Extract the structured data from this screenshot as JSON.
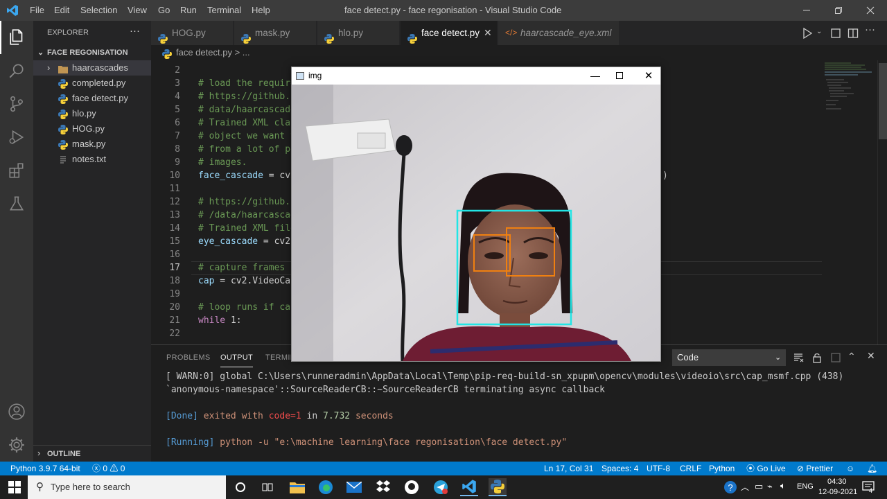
{
  "window": {
    "title": "face detect.py - face regonisation - Visual Studio Code",
    "menu": [
      "File",
      "Edit",
      "Selection",
      "View",
      "Go",
      "Run",
      "Terminal",
      "Help"
    ]
  },
  "sidebar": {
    "title": "EXPLORER",
    "more": "···",
    "folder": "FACE REGONISATION",
    "items": [
      {
        "label": "haarcascades",
        "type": "folder"
      },
      {
        "label": "completed.py",
        "type": "python"
      },
      {
        "label": "face detect.py",
        "type": "python"
      },
      {
        "label": "hlo.py",
        "type": "python"
      },
      {
        "label": "HOG.py",
        "type": "python"
      },
      {
        "label": "mask.py",
        "type": "python"
      },
      {
        "label": "notes.txt",
        "type": "text"
      }
    ],
    "outline": "OUTLINE"
  },
  "tabs": [
    {
      "label": "HOG.py",
      "active": false
    },
    {
      "label": "mask.py",
      "active": false
    },
    {
      "label": "hlo.py",
      "active": false
    },
    {
      "label": "face detect.py",
      "active": true
    },
    {
      "label": "haarcascade_eye.xml",
      "active": false
    }
  ],
  "breadcrumb": {
    "file": "face detect.py",
    "rest": "> ..."
  },
  "editor": {
    "lines": [
      {
        "n": "2",
        "parts": []
      },
      {
        "n": "3",
        "parts": [
          {
            "c": "cmt",
            "t": "# load the require"
          }
        ]
      },
      {
        "n": "4",
        "parts": [
          {
            "c": "cmt",
            "t": "# https://github.c"
          }
        ]
      },
      {
        "n": "5",
        "parts": [
          {
            "c": "cmt",
            "t": "# data/haarcascade"
          }
        ]
      },
      {
        "n": "6",
        "parts": [
          {
            "c": "cmt",
            "t": "# Trained XML clas"
          }
        ]
      },
      {
        "n": "7",
        "parts": [
          {
            "c": "cmt",
            "t": "# object we want t"
          }
        ]
      },
      {
        "n": "8",
        "parts": [
          {
            "c": "cmt",
            "t": "# from a lot of po"
          }
        ]
      },
      {
        "n": "9",
        "parts": [
          {
            "c": "cmt",
            "t": "# images."
          }
        ]
      },
      {
        "n": "10",
        "parts": [
          {
            "c": "var",
            "t": "face_cascade"
          },
          {
            "c": "plain",
            "t": " = cv2"
          }
        ]
      },
      {
        "n": "11",
        "parts": []
      },
      {
        "n": "12",
        "parts": [
          {
            "c": "cmt",
            "t": "# https://github.c"
          }
        ]
      },
      {
        "n": "13",
        "parts": [
          {
            "c": "cmt",
            "t": "# /data/haarcascad"
          }
        ]
      },
      {
        "n": "14",
        "parts": [
          {
            "c": "cmt",
            "t": "# Trained XML file"
          }
        ]
      },
      {
        "n": "15",
        "parts": [
          {
            "c": "var",
            "t": "eye_cascade"
          },
          {
            "c": "plain",
            "t": " = cv2."
          }
        ]
      },
      {
        "n": "16",
        "parts": []
      },
      {
        "n": "17",
        "parts": [
          {
            "c": "cmt",
            "t": "# capture frames f"
          }
        ]
      },
      {
        "n": "18",
        "parts": [
          {
            "c": "var",
            "t": "cap"
          },
          {
            "c": "plain",
            "t": " = cv2.VideoCap"
          }
        ]
      },
      {
        "n": "19",
        "parts": []
      },
      {
        "n": "20",
        "parts": [
          {
            "c": "cmt",
            "t": "# loop runs if cap"
          }
        ]
      },
      {
        "n": "21",
        "parts": [
          {
            "c": "kw",
            "t": "while"
          },
          {
            "c": "plain",
            "t": " 1:"
          }
        ]
      },
      {
        "n": "22",
        "parts": []
      }
    ],
    "paren": ")"
  },
  "panel": {
    "tabs": [
      "PROBLEMS",
      "OUTPUT",
      "TERMIN"
    ],
    "dropdown": "Code",
    "output": {
      "l1": "[ WARN:0] global C:\\Users\\runneradmin\\AppData\\Local\\Temp\\pip-req-build-sn_xpupm\\opencv\\modules\\videoio\\src\\cap_msmf.cpp (438)",
      "l2": "`anonymous-namespace'::SourceReaderCB::~SourceReaderCB terminating async callback",
      "done_tag": "[Done]",
      "done_mid": " exited with ",
      "done_code": "code=1",
      "done_in": " in ",
      "done_time": "7.732",
      "done_sec": " seconds",
      "run_tag": "[Running]",
      "run_cmd": " python -u \"e:\\machine learning\\face regonisation\\face detect.py\""
    }
  },
  "img_window": {
    "title": "img"
  },
  "statusbar": {
    "python": "Python 3.9.7 64-bit",
    "errors": "0",
    "warnings": "0",
    "position": "Ln 17, Col 31",
    "spaces": "Spaces: 4",
    "encoding": "UTF-8",
    "eol": "CRLF",
    "language": "Python",
    "golive": "Go Live",
    "prettier": "Prettier"
  },
  "taskbar": {
    "search_placeholder": "Type here to search",
    "lang": "ENG",
    "time": "04:30",
    "date": "12-09-2021",
    "notif": "4"
  },
  "colors": {
    "accent": "#007acc",
    "comment": "#6a9955",
    "variable": "#9cdcfe",
    "keyword": "#c586c0",
    "face_box": "#22e5e5",
    "eye_box": "#f08010"
  }
}
